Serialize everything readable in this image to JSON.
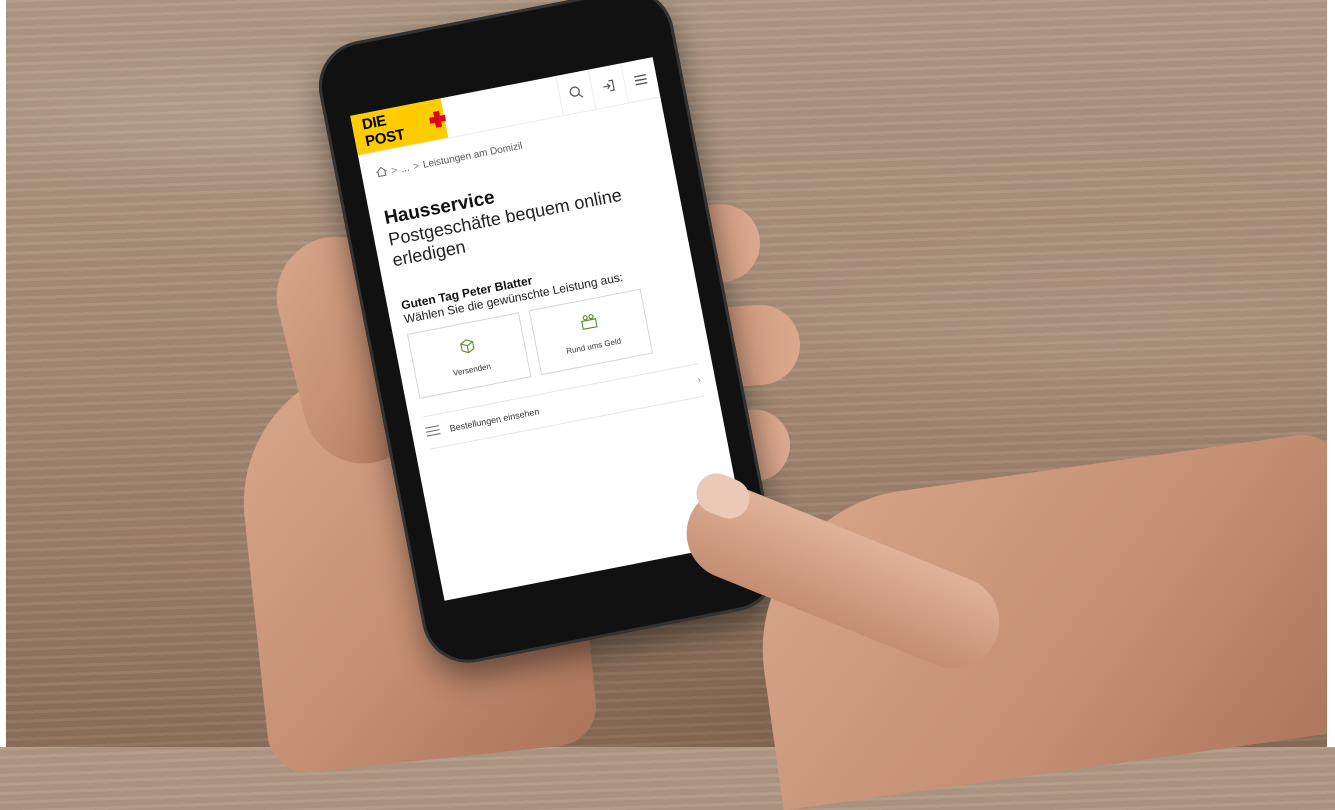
{
  "header": {
    "logo_text": "DIE POST",
    "icons": [
      "search-icon",
      "login-icon",
      "menu-icon"
    ],
    "brand_color": "#ffcc00",
    "cross_color": "#e2001a"
  },
  "breadcrumb": {
    "home_icon": "home-icon",
    "ellipsis": "...",
    "current": "Leistungen am Domizil"
  },
  "page": {
    "title": "Hausservice",
    "subtitle": "Postgeschäfte bequem online erledigen",
    "greeting": "Guten Tag Peter Blatter",
    "prompt": "Wählen Sie die gewünschte Leistung aus:"
  },
  "tiles": [
    {
      "label": "Versenden",
      "icon": "package-icon"
    },
    {
      "label": "Rund ums Geld",
      "icon": "money-icon"
    }
  ],
  "list": [
    {
      "label": "Bestellungen einsehen",
      "icon": "list-icon"
    }
  ]
}
